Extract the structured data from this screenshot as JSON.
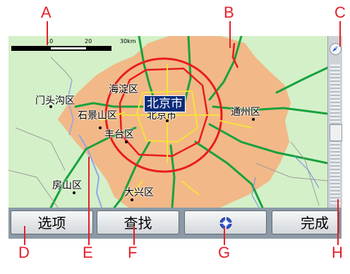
{
  "callouts": [
    "A",
    "B",
    "C",
    "D",
    "E",
    "F",
    "G",
    "H"
  ],
  "map": {
    "capital": "北京市",
    "districts": {
      "haidian": "海淀区",
      "mentougou": "门头沟区",
      "shijingshan": "石景山区",
      "beijing_city": "北京市",
      "tongzhou": "通州区",
      "fengtai": "丰台区",
      "fangshan": "房山区",
      "daxing": "大兴区"
    },
    "scale": {
      "tick1": "10",
      "tick2": "20",
      "tick3": "30km"
    },
    "colors": {
      "urban": "#f2b888",
      "land": "#d4f0c8",
      "ring_road": "#e81c1c",
      "highway": "#17a23d",
      "road": "#f4e23a"
    }
  },
  "toolbar": {
    "options_label": "选项",
    "find_label": "查找",
    "center_icon": "crosshair-icon",
    "done_label": "完成"
  },
  "scrollbar": {
    "compass_icon": "compass-icon"
  }
}
